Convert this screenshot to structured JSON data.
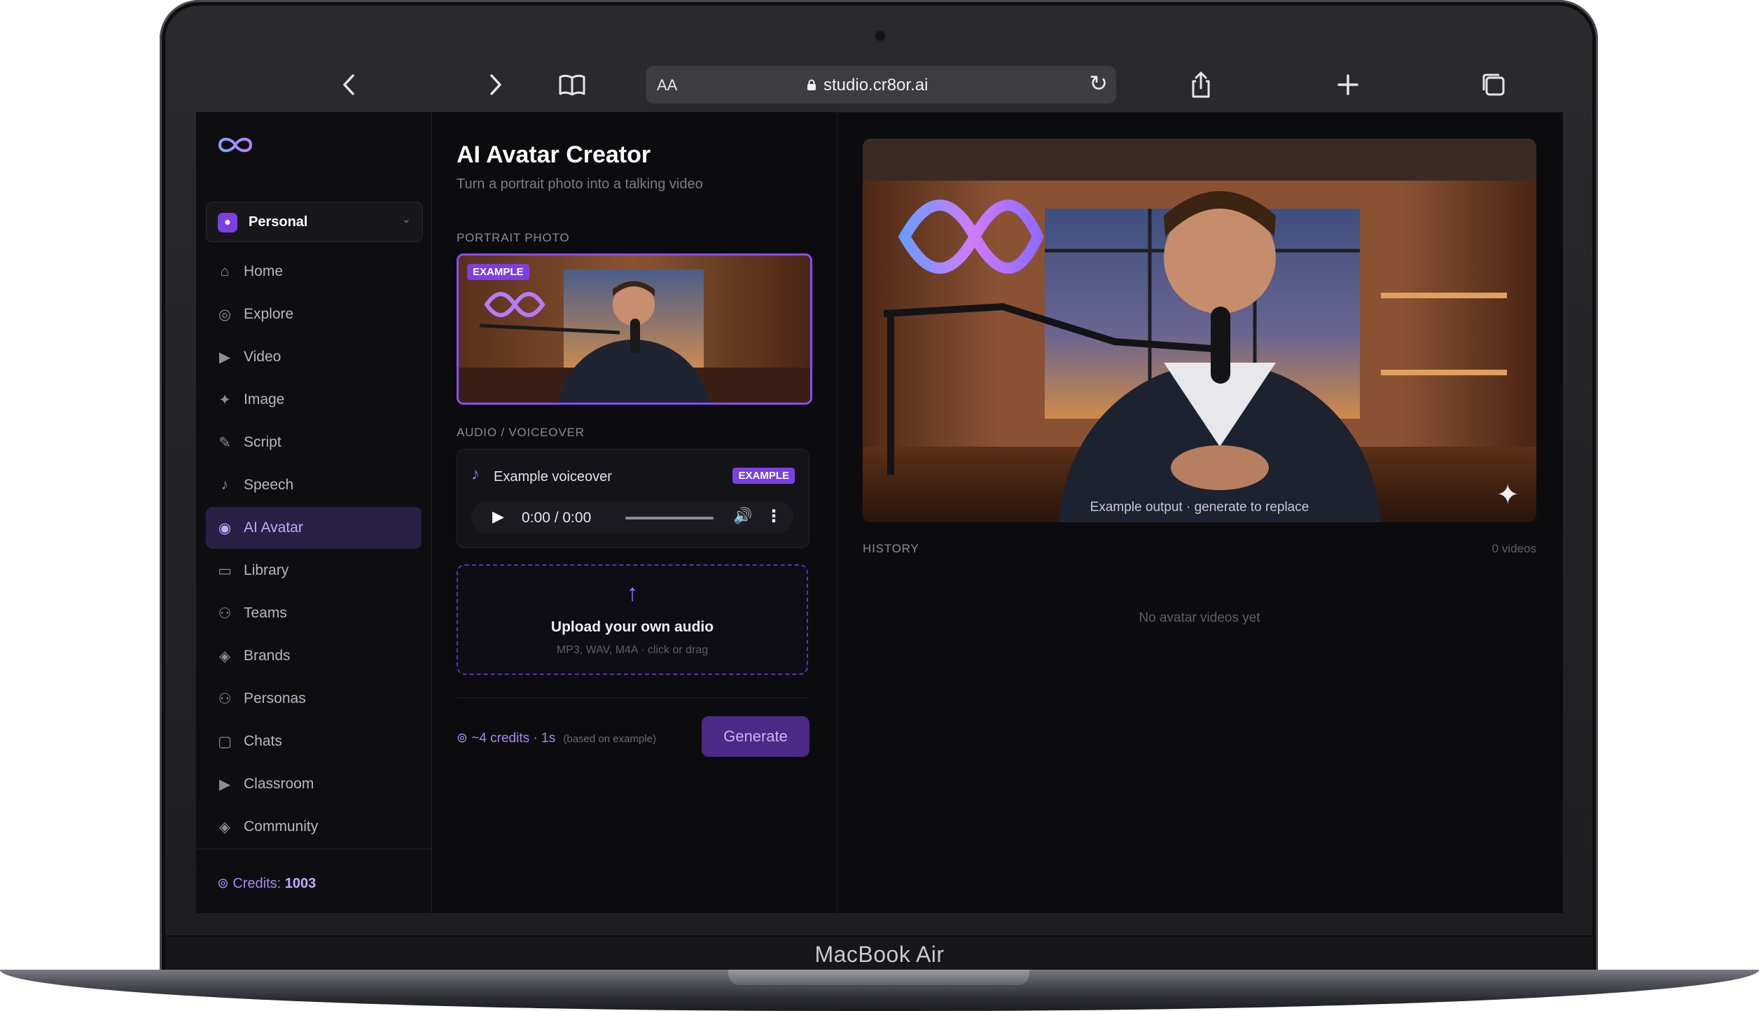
{
  "device": {
    "brand": "MacBook Air"
  },
  "browser": {
    "text_size_label": "AA",
    "url": "studio.cr8or.ai",
    "icons": [
      "back-icon",
      "forward-icon",
      "bookmarks-icon",
      "lock-icon",
      "reload-icon",
      "share-icon",
      "new-tab-icon",
      "tabs-icon"
    ]
  },
  "sidebar": {
    "workspace": "Personal",
    "items": [
      {
        "label": "Home",
        "icon": "⌂"
      },
      {
        "label": "Explore",
        "icon": "◎"
      },
      {
        "label": "Video",
        "icon": "▶"
      },
      {
        "label": "Image",
        "icon": "✦"
      },
      {
        "label": "Script",
        "icon": "✎"
      },
      {
        "label": "Speech",
        "icon": "♪"
      },
      {
        "label": "AI Avatar",
        "icon": "◉"
      },
      {
        "label": "Library",
        "icon": "▭"
      },
      {
        "label": "Teams",
        "icon": "⚇"
      },
      {
        "label": "Brands",
        "icon": "◈"
      },
      {
        "label": "Personas",
        "icon": "⚇"
      },
      {
        "label": "Chats",
        "icon": "▢"
      },
      {
        "label": "Classroom",
        "icon": "▶"
      },
      {
        "label": "Community",
        "icon": "◈"
      }
    ],
    "active_item": "AI Avatar",
    "credits_label": "Credits:",
    "credits_value": "1003"
  },
  "main": {
    "title": "AI Avatar Creator",
    "subtitle": "Turn a portrait photo into a talking video",
    "portrait_label": "PORTRAIT PHOTO",
    "example_tag": "EXAMPLE",
    "audio_label": "AUDIO / VOICEOVER",
    "voiceover_name": "Example voiceover",
    "player_time": "0:00 / 0:00",
    "upload_title": "Upload your own audio",
    "upload_hint": "MP3, WAV, M4A · click or drag",
    "cost_credits": "~4 credits",
    "cost_separator": "·",
    "cost_duration": "1s",
    "cost_note": "(based on example)",
    "generate_label": "Generate"
  },
  "output": {
    "caption": "Example output · generate to replace",
    "history_label": "HISTORY",
    "history_count": "0 videos",
    "empty_text": "No avatar videos yet"
  },
  "colors": {
    "accent": "#7b3fe4",
    "accent_light": "#a887f2",
    "background": "#0c0c0f",
    "sidebar_active": "#2a1f45"
  }
}
